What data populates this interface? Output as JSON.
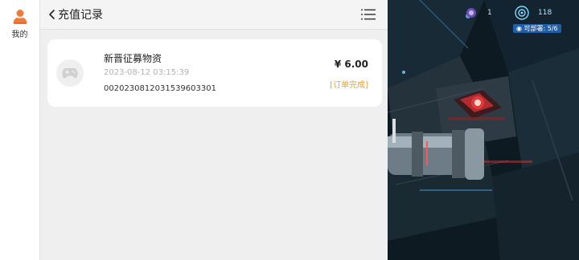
{
  "sidebar": {
    "user_label": "我的"
  },
  "header": {
    "title": "充值记录"
  },
  "records": [
    {
      "name": "新晋征募物资",
      "time": "2023-08-12 03:15:39",
      "order_no": "002023081203153960330​1",
      "amount": "¥ 6.00",
      "status": "[订单完成]"
    }
  ],
  "game_hud": {
    "counter": "1",
    "level": "118",
    "deploy": "可部署: 5/6"
  },
  "colors": {
    "status": "#e3a23b",
    "accent_orange": "#f07a3a",
    "hud_blue": "#1f5fa8"
  },
  "icons": [
    "user-icon",
    "back-chevron-icon",
    "list-menu-icon",
    "gamepad-icon",
    "target-icon",
    "person-icon"
  ]
}
